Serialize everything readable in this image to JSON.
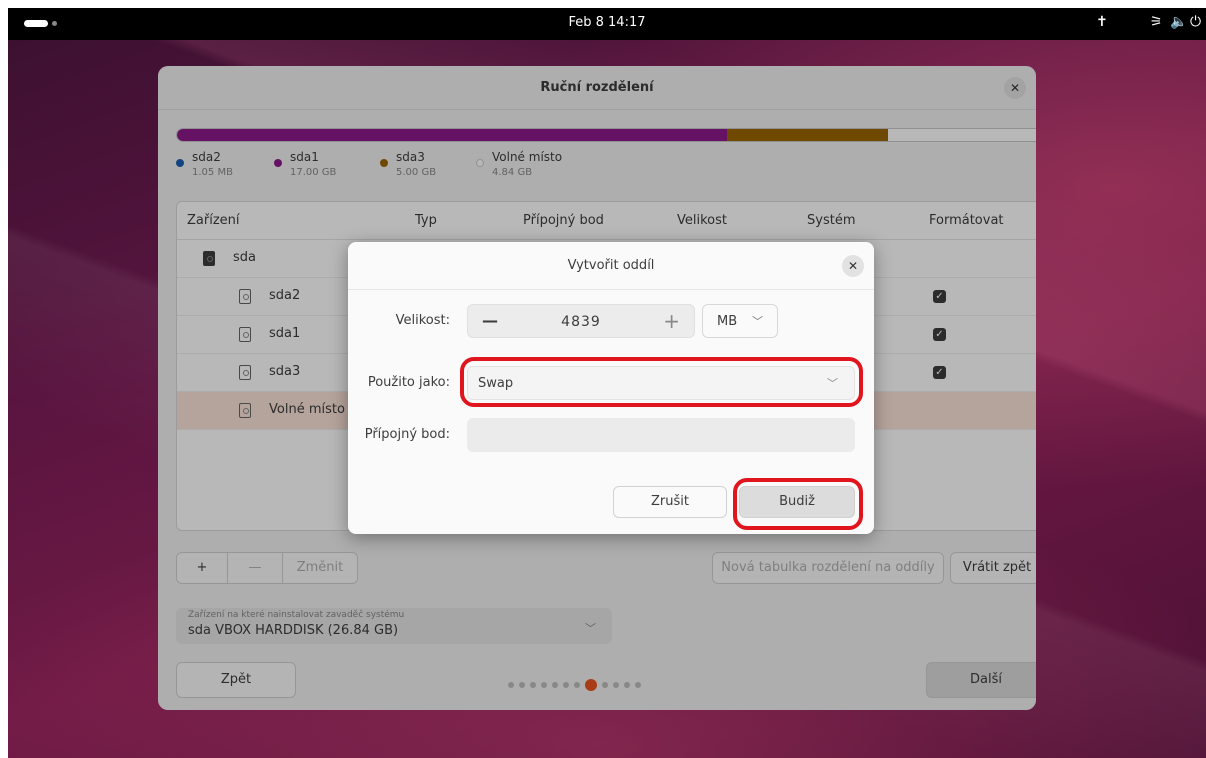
{
  "topbar": {
    "clock": "Feb 8  14:17",
    "icons": [
      "activities-pill",
      "accessibility-icon",
      "network-icon",
      "volume-icon",
      "power-icon"
    ]
  },
  "main": {
    "title": "Ruční rozdělení",
    "partitions_bar": [
      {
        "name": "sda2",
        "size": "1.05 MB",
        "color": "#1a5fb4",
        "fraction": 0.001
      },
      {
        "name": "sda1",
        "size": "17.00 GB",
        "color": "#8d1a8c",
        "fraction": 0.633
      },
      {
        "name": "sda3",
        "size": "5.00 GB",
        "color": "#9c6600",
        "fraction": 0.186
      },
      {
        "name": "Volné místo",
        "size": "4.84 GB",
        "color": "#ffffff",
        "fraction": 0.18
      }
    ],
    "table": {
      "headers": [
        "Zařízení",
        "Typ",
        "Přípojný bod",
        "Velikost",
        "Systém",
        "Formátovat"
      ],
      "rows": [
        {
          "label": "sda",
          "level": 0,
          "checked": false
        },
        {
          "label": "sda2",
          "level": 1,
          "checked": true
        },
        {
          "label": "sda1",
          "level": 1,
          "checked": true
        },
        {
          "label": "sda3",
          "level": 1,
          "checked": true
        },
        {
          "label": "Volné místo",
          "level": 1,
          "checked": false,
          "selected": true
        }
      ]
    },
    "toolbar": {
      "add": "+",
      "remove": "—",
      "change": "Změnit",
      "new_table": "Nová tabulka rozdělení na oddíly",
      "revert": "Vrátit zpět"
    },
    "boot_device": {
      "label": "Zařízení na které nainstalovat zavaděč systému",
      "value": "sda VBOX HARDDISK (26.84 GB)"
    },
    "nav": {
      "back": "Zpět",
      "next": "Další",
      "steps_total": 12,
      "step_active": 8
    }
  },
  "dialog": {
    "title": "Vytvořit oddíl",
    "size_label": "Velikost:",
    "size_value": "4839",
    "unit": "MB",
    "used_as_label": "Použito jako:",
    "used_as_value": "Swap",
    "mount_label": "Přípojný bod:",
    "mount_value": "",
    "cancel": "Zrušit",
    "ok": "Budiž"
  },
  "colors": {
    "accent": "#e95420",
    "highlight_ring": "#e0151d"
  }
}
